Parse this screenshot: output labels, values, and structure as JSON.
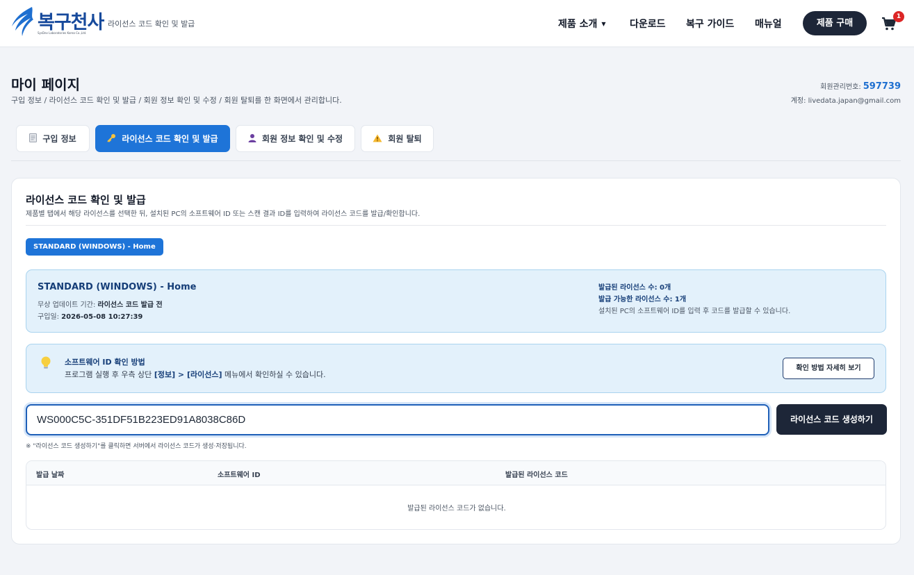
{
  "brand": {
    "name": "복구천사",
    "tagline": "SysDev Laboratories Korea Co.,Ltd.",
    "subtitle": "라이선스 코드 확인 및 발급",
    "color": "#174a9c"
  },
  "nav": {
    "items": [
      "제품 소개",
      "다운로드",
      "복구 가이드",
      "매뉴얼"
    ],
    "buy_label": "제품 구매",
    "cart_count": "1"
  },
  "page": {
    "title": "마이 페이지",
    "description": "구입 정보 / 라이선스 코드 확인 및 발급 / 회원 정보 확인 및 수정 / 회원 탈퇴를 한 화면에서 관리합니다.",
    "member_no_label": "회원관리번호:",
    "member_no": "597739",
    "account": "계정: livedata.japan@gmail.com"
  },
  "tabs": [
    {
      "label": "구입 정보",
      "icon": "receipt-icon",
      "active": false
    },
    {
      "label": "라이선스 코드 확인 및 발급",
      "icon": "key-icon",
      "active": true
    },
    {
      "label": "회원 정보 확인 및 수정",
      "icon": "user-icon",
      "active": false
    },
    {
      "label": "회원 탈퇴",
      "icon": "warning-icon",
      "active": false
    }
  ],
  "license": {
    "title": "라이선스 코드 확인 및 발급",
    "description": "제품별 탭에서 해당 라이선스를 선택한 뒤, 설치된 PC의 소프트웨어 ID 또는 스캔 결과 ID를 입력하여 라이선스 코드를 발급/확인합니다.",
    "product_chip": "STANDARD (WINDOWS) - Home",
    "info": {
      "name": "STANDARD (WINDOWS) - Home",
      "update_label": "무상 업데이트 기간:",
      "update_value": "라이선스 코드 발급 전",
      "purchase_label": "구입일:",
      "purchase_value": "2026-05-08 10:27:39",
      "issued": "발급된 라이선스 수: 0개",
      "available": "발급 가능한 라이선스 수: 1개",
      "hint": "설치된 PC의 소프트웨어 ID를 입력 후 코드를 발급할 수 있습니다."
    },
    "tip": {
      "title": "소프트웨어 ID 확인 방법",
      "text_before": "프로그램 실행 후 우측 상단 ",
      "text_bold": "[정보] > [라이선스]",
      "text_after": " 메뉴에서 확인하실 수 있습니다.",
      "button": "확인 방법 자세히 보기"
    },
    "input_value": "WS000C5C-351DF51B223ED91A8038C86D",
    "generate_label": "라이선스 코드 생성하기",
    "note": "※ \"라이선스 코드 생성하기\"를 클릭하면 서버에서 라이선스 코드가 생성·저장됩니다.",
    "table": {
      "columns": [
        "발급 날짜",
        "소프트웨어 ID",
        "발급된 라이선스 코드"
      ],
      "empty": "발급된 라이선스 코드가 없습니다."
    }
  },
  "colors": {
    "accent": "#1e74d8",
    "dark": "#1d2638",
    "info_bg": "#e3f1fb"
  }
}
